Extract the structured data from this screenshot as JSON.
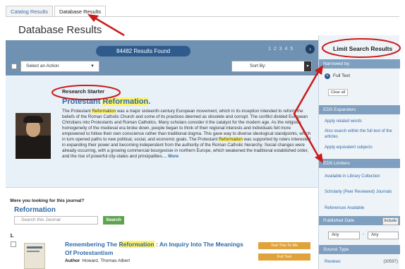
{
  "tabs": [
    {
      "label": "Catalog Results"
    },
    {
      "label": "Database Results"
    }
  ],
  "page_title": "Database Results",
  "results_bar": {
    "found": "84482 Results Found",
    "pages": "1 2 3 4 5",
    "action_select": "Select an Action",
    "sort_select": "Sort By:"
  },
  "research_starter": {
    "heading": "Research Starter",
    "title_prefix": "Protestant ",
    "title_highlight": "Reformation",
    "title_suffix": ".",
    "body_1": "The Protestant ",
    "body_hl_1": "Reformation",
    "body_2": " was a major sixteenth-century European movement, which in its inception intended to reform the beliefs of the Roman Catholic Church and some of its practices deemed as obsolete and corrupt. The conflict divided European Christians into Protestants and Roman Catholics. Many scholars consider it the catalyst for the modern age. As the religious homogeneity of the medieval era broke down, people began to think of their regional interests and individuals felt more empowered to follow their own conscience rather than traditional dogma. This gave way to diverse ideological standpoints, which in turn opened paths to new political, social, and economic goals. The Protestant ",
    "body_hl_2": "Reformation",
    "body_3": " was supported by rulers interested in expanding their power and becoming independent from the authority of the Roman Catholic hierarchy. Social changes were already occurring, with a growing commercial bourgeoisie in northern Europe, which weakened the traditional established order, and the rise of powerful city-states and principalities.... ",
    "more": "More"
  },
  "journal": {
    "question": "Were you looking for this journal?",
    "title": "Reformation",
    "placeholder": "Search this Journal",
    "search_label": "Search"
  },
  "result": {
    "number": "1.",
    "title_prefix": "Remembering The ",
    "title_highlight": "Reformation",
    "title_suffix": " : An Inquiry Into The Meanings Of Protestantism",
    "author_label": "Author",
    "author": "Howard, Thomas Albert",
    "btn_text_to_me": "Text This To Me",
    "btn_full_text": "Full Text"
  },
  "sidebar": {
    "title": "Limit Search Results",
    "narrowed_by": "Narrowed by:",
    "full_text": "Full Text",
    "clear_all": "Clear all",
    "expanders_header": "EDS Expanders",
    "expanders": [
      "Apply related words",
      "Also search within the full text of the articles",
      "Apply equivalent subjects"
    ],
    "limiters_header": "EDS Limiters",
    "limiters": [
      "Available in Library Collection",
      "Scholarly (Peer Reviewed) Journals",
      "References Available"
    ],
    "published_date": "Published Date",
    "include_label": "Include",
    "any_from": "Any",
    "date_separator": "-",
    "any_to": "Any",
    "source_type_header": "Source Type",
    "source_item": "Reviews",
    "source_count": "(30597)"
  },
  "colors": {
    "accent": "#2e5b8c",
    "highlight": "#fff36b",
    "annotation": "#cc1a1a"
  }
}
